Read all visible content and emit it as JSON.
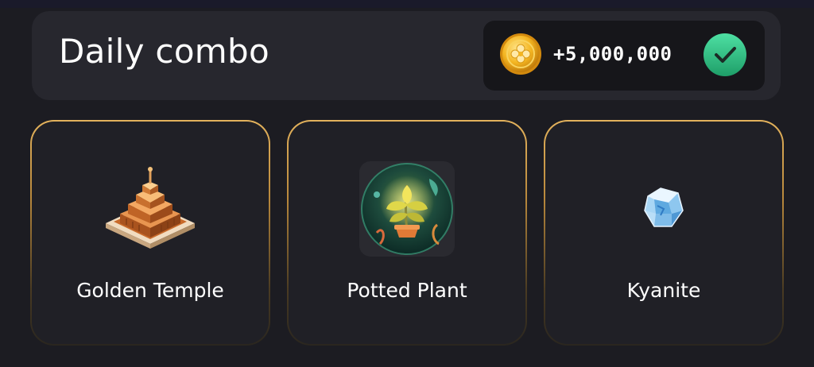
{
  "header": {
    "title": "Daily combo",
    "reward_amount": "+5,000,000"
  },
  "cards": [
    {
      "label": "Golden Temple",
      "icon": "golden-temple-icon"
    },
    {
      "label": "Potted Plant",
      "icon": "potted-plant-icon"
    },
    {
      "label": "Kyanite",
      "icon": "kyanite-icon"
    }
  ],
  "colors": {
    "background": "#1c1c22",
    "panel": "#27272e",
    "card_border": "#e3b25c",
    "check_green": "#2fbf83",
    "coin_gold": "#f4b521"
  }
}
